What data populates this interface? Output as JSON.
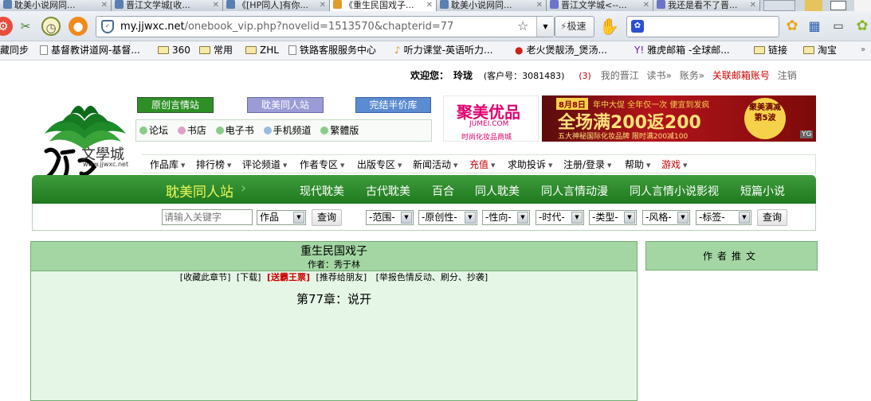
{
  "browser": {
    "tabs": [
      {
        "label": "耽美小说网同..."
      },
      {
        "label": "晋江文学城[收..."
      },
      {
        "label": "《[HP同人]有你..."
      },
      {
        "label": "《重生民国戏子..."
      },
      {
        "label": "耽美小说网同..."
      },
      {
        "label": "晋江文学城<--..."
      },
      {
        "label": "我还是看不了晋..."
      }
    ],
    "url_host": "my.jjwxc.net",
    "url_path": "/onebook_vip.php?novelid=1513570&chapterid=77",
    "mode_label": "极速",
    "bookmarks": [
      "藏同步",
      "基督教讲道网-基督...",
      "360",
      "常用",
      "ZHL",
      "铁路客服服务中心",
      "听力课堂-英语听力...",
      "老火煲靓汤_煲汤...",
      "雅虎邮箱 -全球邮...",
      "链接",
      "淘宝"
    ]
  },
  "site": {
    "welcome_prefix": "欢迎您：",
    "username": "玲珑",
    "customer_label": "(客户号：3081483)",
    "msg_count": "(3)",
    "links": [
      "我的晋江",
      "读书»",
      "账务»",
      "关联邮箱账号",
      "注销"
    ],
    "logo_text": "文學城",
    "logo_url": "www.jjwxc.net",
    "header_buttons": [
      "原创言情站",
      "耽美同人站",
      "完结半价库"
    ],
    "sub_links": [
      "论坛",
      "书店",
      "电子书",
      "手机频道",
      "繁體版"
    ],
    "ad1_brand": "聚美优品",
    "ad1_domain": "JUMEI.COM",
    "ad1_slogan": "时尚化妆品商城",
    "ad2_date": "8月8日",
    "ad2_line1": "年中大促 全年仅一次 便宜到发疯",
    "ad2_main": "全场满200返200",
    "ad2_sub": "五大神秘国际化妆品牌 限时满200减100",
    "ad2_badge": "聚美满减第5波",
    "menu": [
      "作品库",
      "排行榜",
      "评论频道",
      "作者专区",
      "出版专区",
      "新闻活动",
      "充值",
      "求助投诉",
      "注册/登录",
      "帮助",
      "游戏"
    ],
    "channel_title": "耽美同人站",
    "channel_links": [
      "现代耽美",
      "古代耽美",
      "百合",
      "同人耽美",
      "同人言情动漫",
      "同人言情小说影视",
      "短篇小说"
    ],
    "search_placeholder": "请输入关键字",
    "search_type": "作品",
    "search_button": "查询",
    "filters": [
      "-范围-",
      "-原创性-",
      "-性向-",
      "-时代-",
      "-类型-",
      "-风格-",
      "-标签-"
    ],
    "filter_button": "查询"
  },
  "book": {
    "title": "重生民国戏子",
    "author_label": "作者：秀于林",
    "actions": [
      "[收藏此章节]",
      "[下载]",
      "[送霸王票]",
      "[推荐给朋友]",
      "[举报色情反动、刷分、抄袭]"
    ],
    "chapter": "第77章：说开",
    "side_title": "作者推文"
  }
}
